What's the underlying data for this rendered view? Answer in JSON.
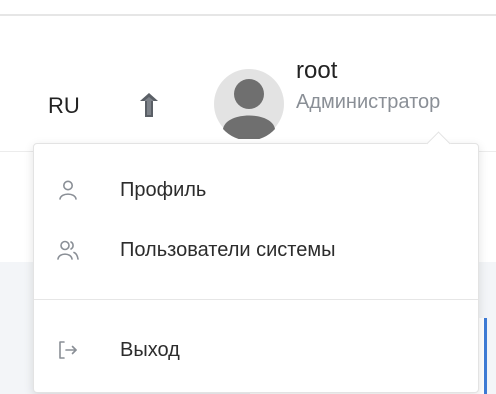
{
  "header": {
    "language": "RU",
    "user": {
      "name": "root",
      "role": "Администратор"
    }
  },
  "user_menu": {
    "items": [
      {
        "label": "Профиль",
        "icon": "user-icon"
      },
      {
        "label": "Пользователи системы",
        "icon": "users-icon"
      }
    ],
    "logout": {
      "label": "Выход",
      "icon": "logout-icon"
    }
  },
  "icons": {
    "tree": "tree-structure-icon",
    "avatar": "user-avatar-icon"
  },
  "colors": {
    "accent": "#3e7bd6",
    "icon": "#8a8f96",
    "text": "#2c2c2c",
    "muted": "#8a8f96"
  }
}
